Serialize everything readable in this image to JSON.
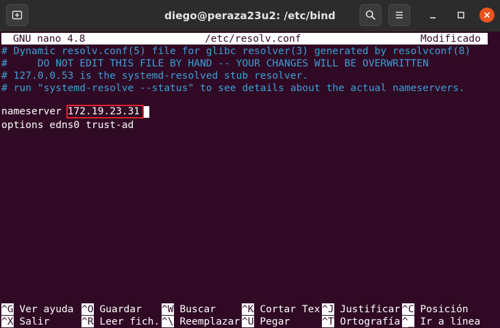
{
  "window": {
    "title": "diego@peraza23u2: /etc/bind",
    "accent_close": "#e95420"
  },
  "nano": {
    "version": "GNU nano 4.8",
    "filename": "/etc/resolv.conf",
    "status": "Modificado"
  },
  "content": {
    "comments": [
      "# Dynamic resolv.conf(5) file for glibc resolver(3) generated by resolvconf(8)",
      "#     DO NOT EDIT THIS FILE BY HAND -- YOUR CHANGES WILL BE OVERWRITTEN",
      "# 127.0.0.53 is the systemd-resolved stub resolver.",
      "# run \"systemd-resolve --status\" to see details about the actual nameservers."
    ],
    "nameserver_key": "nameserver ",
    "nameserver_value": "172.19.23.31",
    "options_line": "options edns0 trust-ad"
  },
  "shortcuts": {
    "row1": [
      {
        "key": "^G",
        "label": " Ver ayuda"
      },
      {
        "key": "^O",
        "label": " Guardar"
      },
      {
        "key": "^W",
        "label": " Buscar"
      },
      {
        "key": "^K",
        "label": " Cortar Tex"
      },
      {
        "key": "^J",
        "label": " Justificar"
      },
      {
        "key": "^C",
        "label": " Posición"
      }
    ],
    "row2": [
      {
        "key": "^X",
        "label": " Salir"
      },
      {
        "key": "^R",
        "label": " Leer fich."
      },
      {
        "key": "^\\",
        "label": " Reemplazar"
      },
      {
        "key": "^U",
        "label": " Pegar"
      },
      {
        "key": "^T",
        "label": " Ortografía"
      },
      {
        "key": "^_",
        "label": " Ir a línea"
      }
    ]
  },
  "icons": {
    "new_tab": "new-tab-icon",
    "search": "search-icon",
    "menu": "hamburger-menu-icon",
    "minimize": "minimize-icon",
    "maximize": "maximize-icon",
    "close": "close-icon"
  }
}
